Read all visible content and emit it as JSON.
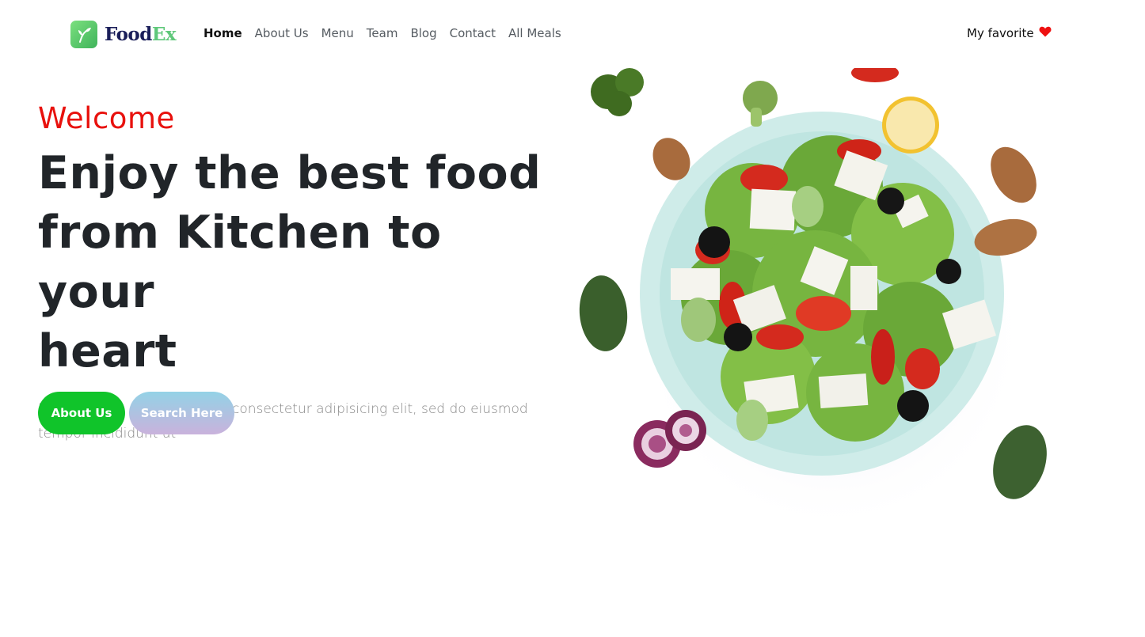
{
  "brand": {
    "name_part1": "Food",
    "name_part2": "Ex"
  },
  "nav": {
    "links": [
      {
        "label": "Home",
        "active": true
      },
      {
        "label": "About Us"
      },
      {
        "label": "Menu"
      },
      {
        "label": "Team"
      },
      {
        "label": "Blog"
      },
      {
        "label": "Contact"
      },
      {
        "label": "All Meals"
      }
    ],
    "favorite_label": "My favorite",
    "favorite_icon": "heart-icon"
  },
  "hero": {
    "welcome": "Welcome",
    "headline_line1": "Enjoy the best food",
    "headline_line2": "from Kitchen to your",
    "headline_line3": "heart",
    "description": "Lorem ipsum dolor sit amet, consectetur adipisicing elit, sed do eiusmod tempor incididunt ut",
    "about_button": "About Us",
    "search_button": "Search Here"
  },
  "colors": {
    "welcome": "#e8110d",
    "heading": "#212529",
    "primary_button": "#10c42a",
    "heart": "#ee1111",
    "brand_dark": "#1b1f5a",
    "brand_green": "#5fc87a"
  }
}
